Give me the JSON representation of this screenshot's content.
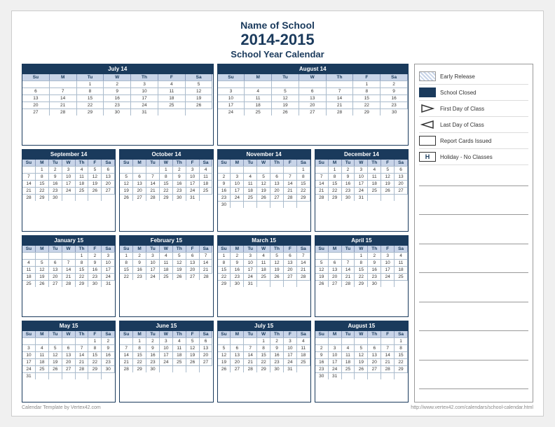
{
  "header": {
    "school_name": "Name of School",
    "year": "2014-2015",
    "subtitle": "School Year Calendar"
  },
  "legend": {
    "items": [
      {
        "id": "early-release",
        "label": "Early Release"
      },
      {
        "id": "school-closed",
        "label": "School Closed"
      },
      {
        "id": "first-day",
        "label": "First Day of Class"
      },
      {
        "id": "last-day",
        "label": "Last Day of Class"
      },
      {
        "id": "report-cards",
        "label": "Report Cards Issued"
      },
      {
        "id": "holiday",
        "label": "Holiday - No Classes"
      }
    ]
  },
  "footer": {
    "left": "Calendar Template by Vertex42.com",
    "right": "http://www.vertex42.com/calendars/school-calendar.html"
  },
  "calendars": [
    {
      "title": "July 14",
      "days": [
        "Su",
        "M",
        "Tu",
        "W",
        "Th",
        "F",
        "Sa"
      ],
      "weeks": [
        [
          "",
          "",
          "1",
          "2",
          "3",
          "4",
          "5"
        ],
        [
          "6",
          "7",
          "8",
          "9",
          "10",
          "11",
          "12"
        ],
        [
          "13",
          "14",
          "15",
          "16",
          "17",
          "18",
          "19"
        ],
        [
          "20",
          "21",
          "22",
          "23",
          "24",
          "25",
          "26"
        ],
        [
          "27",
          "28",
          "29",
          "30",
          "31",
          "",
          ""
        ]
      ]
    },
    {
      "title": "August 14",
      "days": [
        "Su",
        "M",
        "Tu",
        "W",
        "Th",
        "F",
        "Sa"
      ],
      "weeks": [
        [
          "",
          "",
          "",
          "",
          "",
          "1",
          "2"
        ],
        [
          "3",
          "4",
          "5",
          "6",
          "7",
          "8",
          "9"
        ],
        [
          "10",
          "11",
          "12",
          "13",
          "14",
          "15",
          "16"
        ],
        [
          "17",
          "18",
          "19",
          "20",
          "21",
          "22",
          "23"
        ],
        [
          "24",
          "25",
          "26",
          "27",
          "28",
          "29",
          "30"
        ]
      ]
    },
    {
      "title": "September 14",
      "days": [
        "Su",
        "M",
        "Tu",
        "W",
        "Th",
        "F",
        "Sa"
      ],
      "weeks": [
        [
          "",
          "1",
          "2",
          "3",
          "4",
          "5",
          "6"
        ],
        [
          "7",
          "8",
          "9",
          "10",
          "11",
          "12",
          "13"
        ],
        [
          "14",
          "15",
          "16",
          "17",
          "18",
          "19",
          "20"
        ],
        [
          "21",
          "22",
          "23",
          "24",
          "25",
          "26",
          "27"
        ],
        [
          "28",
          "29",
          "30",
          "",
          "",
          "",
          ""
        ]
      ]
    },
    {
      "title": "October 14",
      "days": [
        "Su",
        "M",
        "Tu",
        "W",
        "Th",
        "F",
        "Sa"
      ],
      "weeks": [
        [
          "",
          "",
          "",
          "1",
          "2",
          "3",
          "4"
        ],
        [
          "5",
          "6",
          "7",
          "8",
          "9",
          "10",
          "11"
        ],
        [
          "12",
          "13",
          "14",
          "15",
          "16",
          "17",
          "18"
        ],
        [
          "19",
          "20",
          "21",
          "22",
          "23",
          "24",
          "25"
        ],
        [
          "26",
          "27",
          "28",
          "29",
          "30",
          "31",
          ""
        ]
      ]
    },
    {
      "title": "November 14",
      "days": [
        "Su",
        "M",
        "Tu",
        "W",
        "Th",
        "F",
        "Sa"
      ],
      "weeks": [
        [
          "",
          "",
          "",
          "",
          "",
          "",
          "1"
        ],
        [
          "2",
          "3",
          "4",
          "5",
          "6",
          "7",
          "8"
        ],
        [
          "9",
          "10",
          "11",
          "12",
          "13",
          "14",
          "15"
        ],
        [
          "16",
          "17",
          "18",
          "19",
          "20",
          "21",
          "22"
        ],
        [
          "23",
          "24",
          "25",
          "26",
          "27",
          "28",
          "29"
        ],
        [
          "30",
          "",
          "",
          "",
          "",
          "",
          ""
        ]
      ]
    },
    {
      "title": "December 14",
      "days": [
        "Su",
        "M",
        "Tu",
        "W",
        "Th",
        "F",
        "Sa"
      ],
      "weeks": [
        [
          "",
          "1",
          "2",
          "3",
          "4",
          "5",
          "6"
        ],
        [
          "7",
          "8",
          "9",
          "10",
          "11",
          "12",
          "13"
        ],
        [
          "14",
          "15",
          "16",
          "17",
          "18",
          "19",
          "20"
        ],
        [
          "21",
          "22",
          "23",
          "24",
          "25",
          "26",
          "27"
        ],
        [
          "28",
          "29",
          "30",
          "31",
          "",
          "",
          ""
        ]
      ]
    },
    {
      "title": "January 15",
      "days": [
        "Su",
        "M",
        "Tu",
        "W",
        "Th",
        "F",
        "Sa"
      ],
      "weeks": [
        [
          "",
          "",
          "",
          "",
          "1",
          "2",
          "3"
        ],
        [
          "4",
          "5",
          "6",
          "7",
          "8",
          "9",
          "10"
        ],
        [
          "11",
          "12",
          "13",
          "14",
          "15",
          "16",
          "17"
        ],
        [
          "18",
          "19",
          "20",
          "21",
          "22",
          "23",
          "24"
        ],
        [
          "25",
          "26",
          "27",
          "28",
          "29",
          "30",
          "31"
        ]
      ]
    },
    {
      "title": "February 15",
      "days": [
        "Su",
        "M",
        "Tu",
        "W",
        "Th",
        "F",
        "Sa"
      ],
      "weeks": [
        [
          "1",
          "2",
          "3",
          "4",
          "5",
          "6",
          "7"
        ],
        [
          "8",
          "9",
          "10",
          "11",
          "12",
          "13",
          "14"
        ],
        [
          "15",
          "16",
          "17",
          "18",
          "19",
          "20",
          "21"
        ],
        [
          "22",
          "23",
          "24",
          "25",
          "26",
          "27",
          "28"
        ]
      ]
    },
    {
      "title": "March 15",
      "days": [
        "Su",
        "M",
        "Tu",
        "W",
        "Th",
        "F",
        "Sa"
      ],
      "weeks": [
        [
          "1",
          "2",
          "3",
          "4",
          "5",
          "6",
          "7"
        ],
        [
          "8",
          "9",
          "10",
          "11",
          "12",
          "13",
          "14"
        ],
        [
          "15",
          "16",
          "17",
          "18",
          "19",
          "20",
          "21"
        ],
        [
          "22",
          "23",
          "24",
          "25",
          "26",
          "27",
          "28"
        ],
        [
          "29",
          "30",
          "31",
          "",
          "",
          "",
          ""
        ]
      ]
    },
    {
      "title": "April 15",
      "days": [
        "Su",
        "M",
        "Tu",
        "W",
        "Th",
        "F",
        "Sa"
      ],
      "weeks": [
        [
          "",
          "",
          "",
          "1",
          "2",
          "3",
          "4"
        ],
        [
          "5",
          "6",
          "7",
          "8",
          "9",
          "10",
          "11"
        ],
        [
          "12",
          "13",
          "14",
          "15",
          "16",
          "17",
          "18"
        ],
        [
          "19",
          "20",
          "21",
          "22",
          "23",
          "24",
          "25"
        ],
        [
          "26",
          "27",
          "28",
          "29",
          "30",
          "",
          ""
        ]
      ]
    },
    {
      "title": "May 15",
      "days": [
        "Su",
        "M",
        "Tu",
        "W",
        "Th",
        "F",
        "Sa"
      ],
      "weeks": [
        [
          "",
          "",
          "",
          "",
          "",
          "1",
          "2"
        ],
        [
          "3",
          "4",
          "5",
          "6",
          "7",
          "8",
          "9"
        ],
        [
          "10",
          "11",
          "12",
          "13",
          "14",
          "15",
          "16"
        ],
        [
          "17",
          "18",
          "19",
          "20",
          "21",
          "22",
          "23"
        ],
        [
          "24",
          "25",
          "26",
          "27",
          "28",
          "29",
          "30"
        ],
        [
          "31",
          "",
          "",
          "",
          "",
          "",
          ""
        ]
      ]
    },
    {
      "title": "June 15",
      "days": [
        "Su",
        "M",
        "Tu",
        "W",
        "Th",
        "F",
        "Sa"
      ],
      "weeks": [
        [
          "",
          "1",
          "2",
          "3",
          "4",
          "5",
          "6"
        ],
        [
          "7",
          "8",
          "9",
          "10",
          "11",
          "12",
          "13"
        ],
        [
          "14",
          "15",
          "16",
          "17",
          "18",
          "19",
          "20"
        ],
        [
          "21",
          "22",
          "23",
          "24",
          "25",
          "26",
          "27"
        ],
        [
          "28",
          "29",
          "30",
          "",
          "",
          "",
          ""
        ]
      ]
    },
    {
      "title": "July 15",
      "days": [
        "Su",
        "M",
        "Tu",
        "W",
        "Th",
        "F",
        "Sa"
      ],
      "weeks": [
        [
          "",
          "",
          "",
          "1",
          "2",
          "3",
          "4"
        ],
        [
          "5",
          "6",
          "7",
          "8",
          "9",
          "10",
          "11"
        ],
        [
          "12",
          "13",
          "14",
          "15",
          "16",
          "17",
          "18"
        ],
        [
          "19",
          "20",
          "21",
          "22",
          "23",
          "24",
          "25"
        ],
        [
          "26",
          "27",
          "28",
          "29",
          "30",
          "31",
          ""
        ]
      ]
    },
    {
      "title": "August 15",
      "days": [
        "Su",
        "M",
        "Tu",
        "W",
        "Th",
        "F",
        "Sa"
      ],
      "weeks": [
        [
          "",
          "",
          "",
          "",
          "",
          "",
          "1"
        ],
        [
          "2",
          "3",
          "4",
          "5",
          "6",
          "7",
          "8"
        ],
        [
          "9",
          "10",
          "11",
          "12",
          "13",
          "14",
          "15"
        ],
        [
          "16",
          "17",
          "18",
          "19",
          "20",
          "21",
          "22"
        ],
        [
          "23",
          "24",
          "25",
          "26",
          "27",
          "28",
          "29"
        ],
        [
          "30",
          "31",
          "",
          "",
          "",
          "",
          ""
        ]
      ]
    }
  ]
}
